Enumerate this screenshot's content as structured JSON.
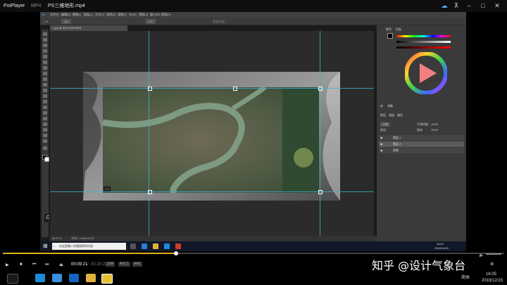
{
  "player": {
    "app_name": "PotPlayer",
    "format": "MP4",
    "file_name": "PS三维地形.mp4"
  },
  "photoshop": {
    "menu": [
      "文件(F)",
      "编辑(E)",
      "图像(I)",
      "图层(L)",
      "文字(Y)",
      "选择(S)",
      "滤镜(T)",
      "3D(D)",
      "视图(V)",
      "窗口(W)",
      "帮助(H)"
    ],
    "options": {
      "width_value": "1px",
      "angle_value": "2.8",
      "field_hint": "宽度/高度"
    },
    "doc_tab": "× jpg @ 66.6%(RGB/8)",
    "panel_tabs": {
      "color": "颜色",
      "swatches": "色板"
    },
    "adjust_tabs": {
      "library": "库",
      "adjustments": "调整"
    },
    "layers_tabs": {
      "layers": "图层",
      "channels": "通道",
      "paths": "路径"
    },
    "layers": {
      "blend_mode": "正常",
      "opacity_label": "不透明度:",
      "opacity_value": "100%",
      "fill_label": "填充:",
      "fill_value": "100%",
      "lock_label": "锁定:",
      "rows": [
        "图层 1",
        "图层 2",
        "背景"
      ]
    },
    "status_zoom": "66.67%",
    "status_doc": "文档:7.64M/26.4M",
    "layer_label": "1 2"
  },
  "windows_taskbar": {
    "search_placeholder": "在这里输入你要搜索的内容",
    "time": "18:02",
    "date": "2018/11/28"
  },
  "controls": {
    "current_time": "00:09:21",
    "total_time": "00:28:28",
    "badges": [
      "S/W",
      "AVC1",
      "AAC"
    ]
  },
  "tray": {
    "time": "16:05",
    "date": "2018/12/15",
    "ime": "简体"
  },
  "watermark": "知乎 @设计气象台",
  "progress": {
    "played_fraction": 0.345
  },
  "colors": {
    "seek_played": "#e0b21a",
    "guide": "#3fb0d8"
  }
}
